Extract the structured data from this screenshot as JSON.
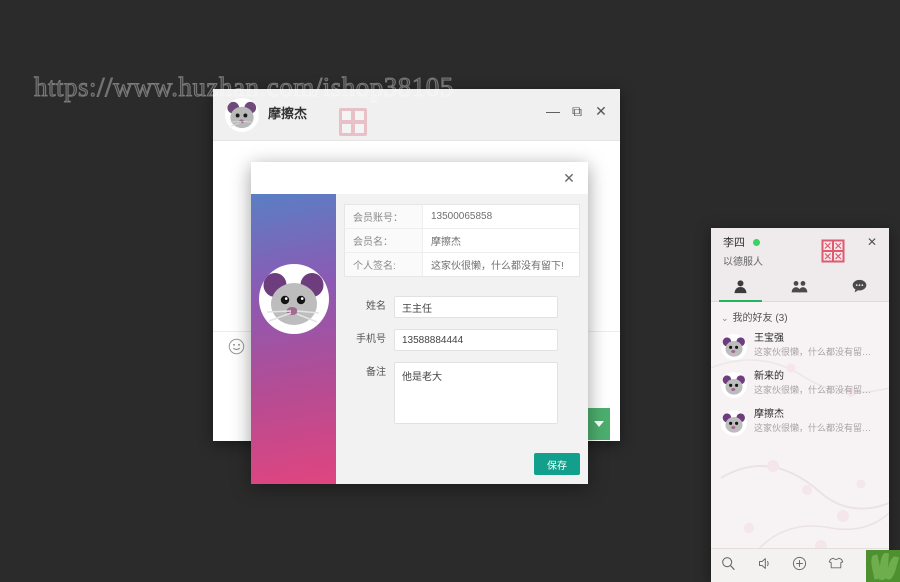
{
  "watermark": {
    "text": "https://www.huzhan.com/ishop38105"
  },
  "chat_window": {
    "title": "摩擦杰",
    "avatar_icon": "mouse-avatar-icon",
    "seal_icon": "red-seal-stamp-icon",
    "emoji_icon": "smiley-face-icon",
    "controls": {
      "minimize": "—",
      "maximize": "⧉",
      "close": "✕"
    },
    "dropdown_icon": "caret-down-icon"
  },
  "modal": {
    "close_label": "✕",
    "avatar_icon": "mouse-avatar-icon",
    "info_rows": [
      {
        "label": "会员账号：",
        "value": "13500065858"
      },
      {
        "label": "会员名：",
        "value": "摩擦杰"
      },
      {
        "label": "个人签名:",
        "value": "这家伙很懒，什么都没有留下!"
      }
    ],
    "form": {
      "name_label": "姓名",
      "name_value": "王主任",
      "phone_label": "手机号",
      "phone_value": "13588884444",
      "remark_label": "备注",
      "remark_value": "他是老大"
    },
    "save_label": "保存",
    "accent_color": "#12a08c"
  },
  "contact_panel": {
    "nickname": "李四",
    "status_color": "#3fcf62",
    "signature": "以德服人",
    "seal_icon": "red-seal-stamp-icon",
    "close_label": "✕",
    "tabs": [
      {
        "name": "contacts",
        "icon": "person-icon",
        "active": true
      },
      {
        "name": "groups",
        "icon": "group-icon",
        "active": false
      },
      {
        "name": "messages",
        "icon": "chat-bubble-icon",
        "active": false
      }
    ],
    "group_chevron": "⌄",
    "group_label": "我的好友 (3)",
    "friends": [
      {
        "name": "王宝强",
        "signature": "这家伙很懒，什么都没有留…"
      },
      {
        "name": "新来的",
        "signature": "这家伙很懒，什么都没有留…"
      },
      {
        "name": "摩擦杰",
        "signature": "这家伙很懒，什么都没有留…"
      }
    ],
    "footer_icons": [
      "search-icon",
      "sound-icon",
      "plus-icon",
      "skin-shirt-icon",
      "apps-icon"
    ],
    "active_tab_color": "#24b35e"
  }
}
